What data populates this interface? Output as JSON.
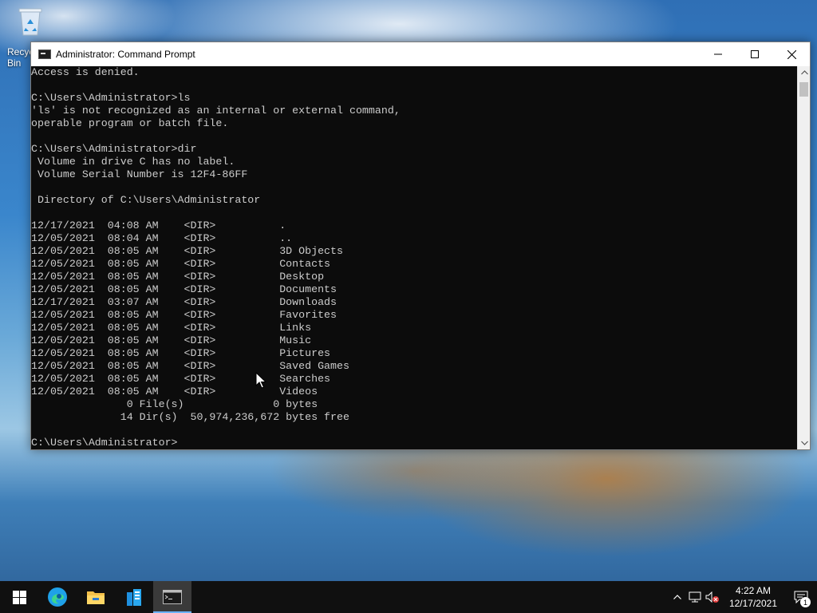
{
  "desktop": {
    "recycle_bin_label": "Recycle Bin"
  },
  "window": {
    "title": "Administrator: Command Prompt",
    "console_text": "Access is denied.\n\nC:\\Users\\Administrator>ls\n'ls' is not recognized as an internal or external command,\noperable program or batch file.\n\nC:\\Users\\Administrator>dir\n Volume in drive C has no label.\n Volume Serial Number is 12F4-86FF\n\n Directory of C:\\Users\\Administrator\n\n12/17/2021  04:08 AM    <DIR>          .\n12/05/2021  08:04 AM    <DIR>          ..\n12/05/2021  08:05 AM    <DIR>          3D Objects\n12/05/2021  08:05 AM    <DIR>          Contacts\n12/05/2021  08:05 AM    <DIR>          Desktop\n12/05/2021  08:05 AM    <DIR>          Documents\n12/17/2021  03:07 AM    <DIR>          Downloads\n12/05/2021  08:05 AM    <DIR>          Favorites\n12/05/2021  08:05 AM    <DIR>          Links\n12/05/2021  08:05 AM    <DIR>          Music\n12/05/2021  08:05 AM    <DIR>          Pictures\n12/05/2021  08:05 AM    <DIR>          Saved Games\n12/05/2021  08:05 AM    <DIR>          Searches\n12/05/2021  08:05 AM    <DIR>          Videos\n               0 File(s)              0 bytes\n              14 Dir(s)  50,974,236,672 bytes free\n\nC:\\Users\\Administrator>",
    "colors": {
      "console_bg": "#0c0c0c",
      "console_fg": "#cccccc"
    }
  },
  "taskbar": {
    "pinned": [
      "start-icon",
      "edge-icon",
      "file-explorer-icon",
      "server-manager-icon",
      "command-prompt-icon"
    ],
    "clock_time": "4:22 AM",
    "clock_date": "12/17/2021",
    "notification_count": "1",
    "accent_color": "#6bb3ff"
  }
}
